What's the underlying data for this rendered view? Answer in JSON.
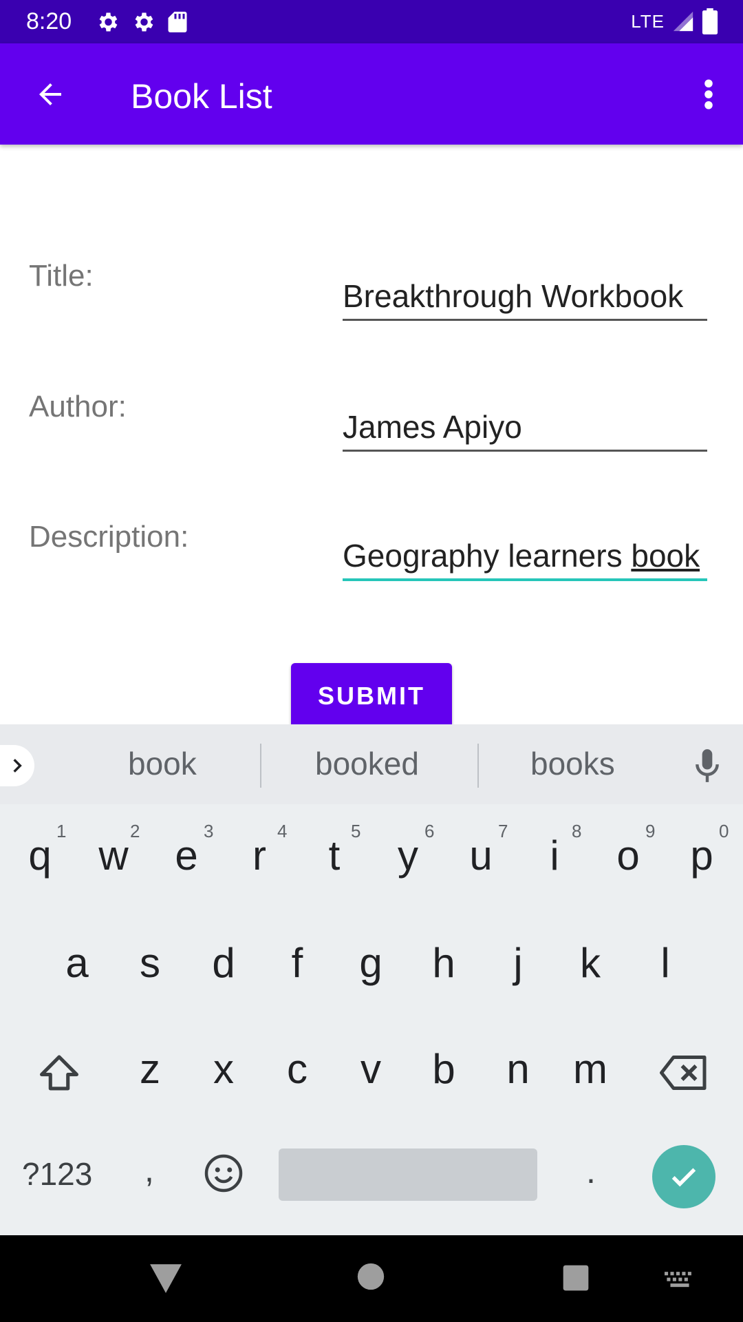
{
  "status_bar": {
    "time": "8:20",
    "network": "LTE",
    "icons": [
      "settings-icon",
      "settings-icon",
      "sd-card-icon",
      "signal-icon",
      "battery-icon"
    ]
  },
  "app_bar": {
    "title": "Book List",
    "back_icon": "arrow-back-icon",
    "menu_icon": "more-vert-icon",
    "color": "#6200ee"
  },
  "form": {
    "title_label": "Title:",
    "title_value": "Breakthrough Workbook",
    "author_label": "Author:",
    "author_value": "James Apiyo",
    "description_label": "Description:",
    "description_value_prefix": "Geography learners ",
    "description_value_composing": "book",
    "submit_label": "SUBMIT",
    "focus_color": "#26c6b9"
  },
  "keyboard": {
    "suggestions": [
      "book",
      "booked",
      "books"
    ],
    "row1": [
      "q",
      "w",
      "e",
      "r",
      "t",
      "y",
      "u",
      "i",
      "o",
      "p"
    ],
    "row1_hints": [
      "1",
      "2",
      "3",
      "4",
      "5",
      "6",
      "7",
      "8",
      "9",
      "0"
    ],
    "row2": [
      "a",
      "s",
      "d",
      "f",
      "g",
      "h",
      "j",
      "k",
      "l"
    ],
    "row3": [
      "z",
      "x",
      "c",
      "v",
      "b",
      "n",
      "m"
    ],
    "symbols_label": "?123",
    "comma": ",",
    "period": ".",
    "enter_color": "#4db6ac"
  },
  "nav_bar": {
    "buttons": [
      "back-triangle-icon",
      "home-circle-icon",
      "recents-square-icon",
      "keyboard-switch-icon"
    ]
  }
}
